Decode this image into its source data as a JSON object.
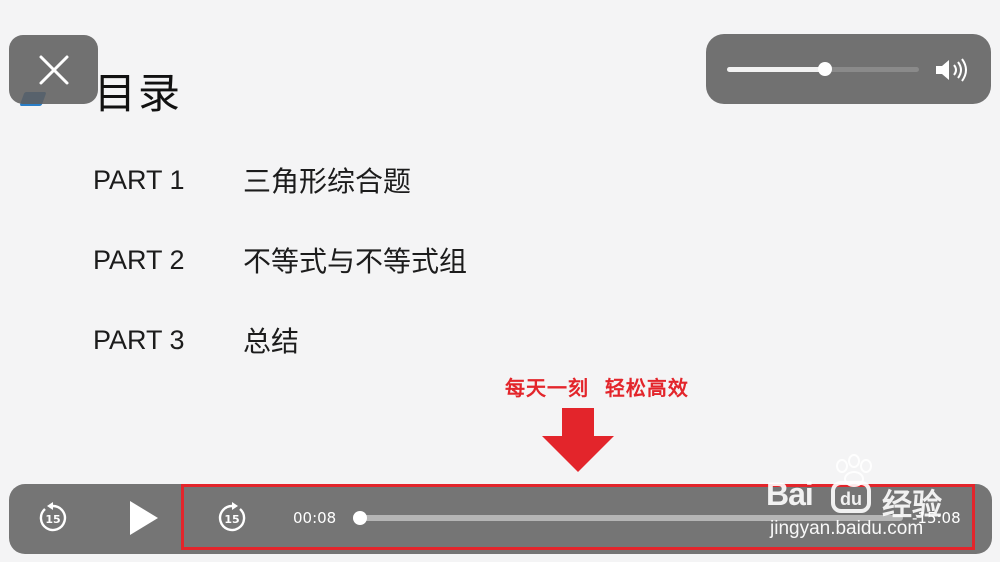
{
  "slide": {
    "title": "目录",
    "items": [
      {
        "part": "PART 1",
        "text": "三角形综合题"
      },
      {
        "part": "PART 2",
        "text": "不等式与不等式组"
      },
      {
        "part": "PART 3",
        "text": "总结"
      }
    ]
  },
  "volume": {
    "level": 0.51,
    "icon": "speaker-icon"
  },
  "annotation": {
    "banner": "每天一刻  轻松高效",
    "color": "#e3252b"
  },
  "player": {
    "current_time": "00:08",
    "remaining_time": "-15:08",
    "progress": 0.01,
    "rewind_icon": "rewind-15-icon",
    "play_icon": "play-icon",
    "forward_icon": "forward-15-icon",
    "skip_seconds": "15"
  },
  "watermark": {
    "brand": "Bai",
    "brand_cn": "经验",
    "url": "jingyan.baidu.com"
  }
}
